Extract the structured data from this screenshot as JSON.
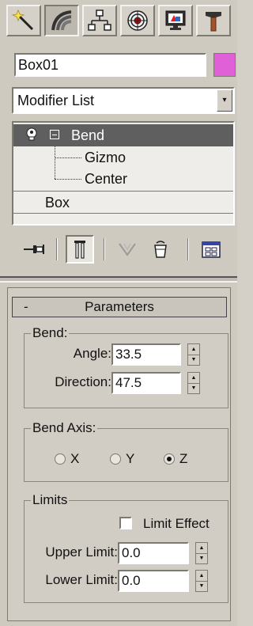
{
  "command_panel": {
    "tabs": [
      {
        "name": "create",
        "icon": "create-wand-icon"
      },
      {
        "name": "modify",
        "icon": "modify-rainbow-icon",
        "active": true
      },
      {
        "name": "hierarchy",
        "icon": "hierarchy-icon"
      },
      {
        "name": "motion",
        "icon": "motion-icon"
      },
      {
        "name": "display",
        "icon": "display-monitor-icon"
      },
      {
        "name": "utilities",
        "icon": "hammer-icon"
      }
    ]
  },
  "object": {
    "name": "Box01",
    "color": "#e060d8"
  },
  "modifier_list": {
    "label": "Modifier List",
    "dropdown_icon": "▾"
  },
  "stack": {
    "items": [
      {
        "label": "Bend",
        "selected": true,
        "icon": "lightbulb-icon"
      },
      {
        "label": "Gizmo"
      },
      {
        "label": "Center"
      },
      {
        "label": "Box"
      }
    ]
  },
  "stack_tools": [
    {
      "name": "pin-stack",
      "icon": "pin-icon"
    },
    {
      "name": "show-end-result",
      "icon": "end-result-icon",
      "pressed": true
    },
    {
      "name": "make-unique",
      "icon": "make-unique-icon"
    },
    {
      "name": "remove-modifier",
      "icon": "trash-icon"
    },
    {
      "name": "configure-sets",
      "icon": "configure-icon"
    }
  ],
  "parameters": {
    "title": "Parameters",
    "collapse_symbol": "-",
    "bend": {
      "group_label": "Bend:",
      "angle_label": "Angle:",
      "angle_value": "33.5",
      "direction_label": "Direction:",
      "direction_value": "47.5"
    },
    "bend_axis": {
      "group_label": "Bend Axis:",
      "options": [
        "X",
        "Y",
        "Z"
      ],
      "selected": "Z"
    },
    "limits": {
      "group_label": "Limits",
      "limit_effect_label": "Limit Effect",
      "limit_effect_checked": false,
      "upper_label": "Upper Limit:",
      "upper_value": "0.0",
      "lower_label": "Lower Limit:",
      "lower_value": "0.0"
    }
  }
}
